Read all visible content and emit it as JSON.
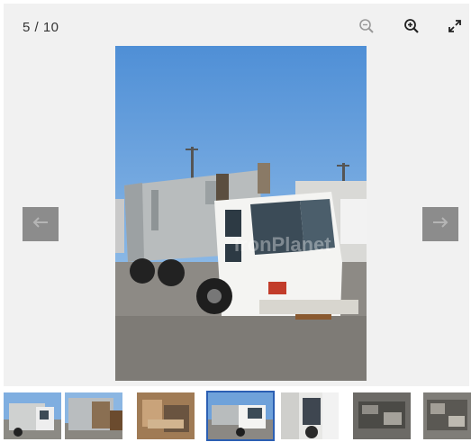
{
  "viewer": {
    "counter": "5 / 10",
    "icons": {
      "zoom_out": "zoom-out-icon",
      "zoom_in": "zoom-in-icon",
      "fullscreen": "expand-icon",
      "prev": "arrow-left-icon",
      "next": "arrow-right-icon"
    },
    "main_image": {
      "watermark": "IronPlanet"
    }
  },
  "thumbnails": [
    {
      "name": "thumbnail-1",
      "active": false
    },
    {
      "name": "thumbnail-2",
      "active": false
    },
    {
      "name": "thumbnail-3",
      "active": false
    },
    {
      "name": "thumbnail-4",
      "active": true
    },
    {
      "name": "thumbnail-5",
      "active": false
    },
    {
      "name": "thumbnail-6",
      "active": false
    },
    {
      "name": "thumbnail-7",
      "active": false
    }
  ],
  "colors": {
    "viewer_bg": "#f1f1f1",
    "arrow_bg": "#8c8c8c",
    "active_border": "#2b5fb3"
  }
}
